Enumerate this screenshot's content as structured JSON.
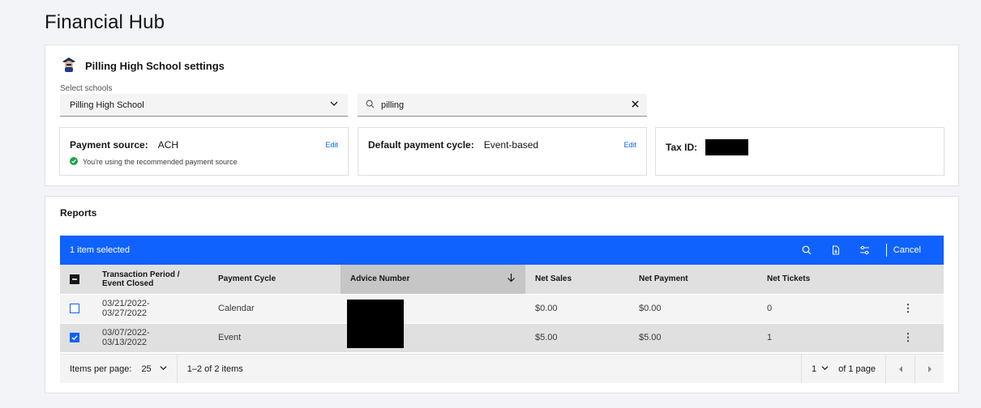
{
  "page": {
    "title": "Financial Hub"
  },
  "settings": {
    "school_title": "Pilling High School settings",
    "select_label": "Select schools",
    "selected_school": "Pilling High School",
    "search_value": "pilling",
    "payment_source": {
      "label": "Payment source:",
      "value": "ACH",
      "edit": "Edit",
      "note": "You're using the recommended payment source"
    },
    "payment_cycle": {
      "label": "Default payment cycle:",
      "value": "Event-based",
      "edit": "Edit"
    },
    "tax": {
      "label": "Tax ID:"
    }
  },
  "reports": {
    "title": "Reports",
    "batch": {
      "selected_text": "1 item selected",
      "cancel": "Cancel"
    },
    "columns": [
      "Transaction Period / Event Closed",
      "Payment Cycle",
      "Advice Number",
      "Net Sales",
      "Net Payment",
      "Net Tickets"
    ],
    "rows": [
      {
        "period": "03/21/2022-\n03/27/2022",
        "cycle": "Calendar",
        "net_sales": "$0.00",
        "net_payment": "$0.00",
        "net_tickets": "0",
        "checked": false
      },
      {
        "period": "03/07/2022-\n03/13/2022",
        "cycle": "Event",
        "net_sales": "$5.00",
        "net_payment": "$5.00",
        "net_tickets": "1",
        "checked": true
      }
    ],
    "pagination": {
      "items_per_page_label": "Items per page:",
      "items_per_page": "25",
      "range": "1–2 of 2 items",
      "page": "1",
      "of_pages": "of 1 page"
    }
  },
  "colors": {
    "primary": "#0f62fe",
    "success": "#24a148"
  },
  "icons": [
    "school-mascot-icon",
    "chevron-down-icon",
    "search-icon",
    "close-icon",
    "success-check-icon",
    "sort-down-icon",
    "download-icon",
    "settings-adjust-icon",
    "overflow-menu-icon",
    "caret-left-icon",
    "caret-right-icon"
  ]
}
